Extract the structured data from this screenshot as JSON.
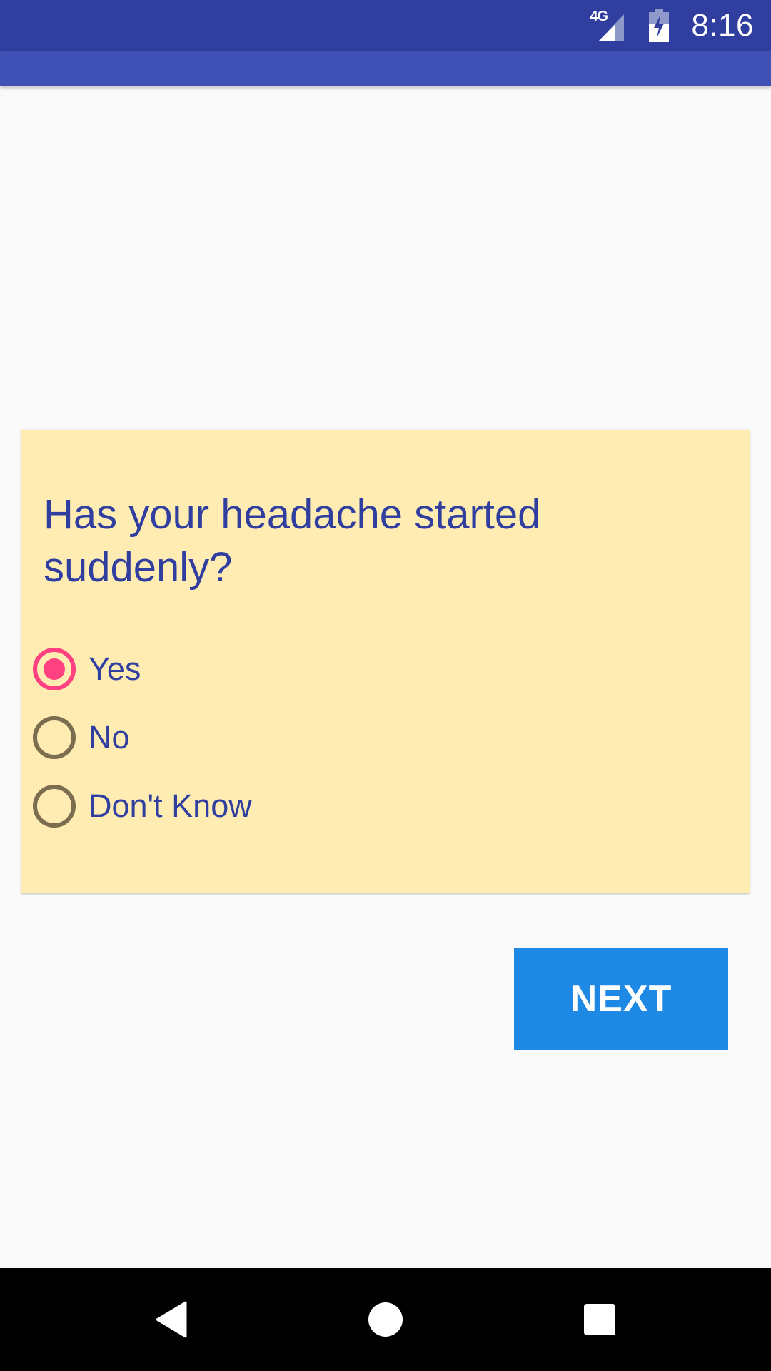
{
  "status_bar": {
    "network_label": "4G",
    "time": "8:16",
    "background_color": "#303f9f"
  },
  "app_bar": {
    "background_color": "#3f51b5"
  },
  "question": {
    "text": "Has your headache started suddenly?",
    "card_color": "#ffecb3",
    "options": [
      {
        "label": "Yes",
        "selected": true
      },
      {
        "label": "No",
        "selected": false
      },
      {
        "label": "Don't Know",
        "selected": false
      }
    ]
  },
  "next_button": {
    "label": "NEXT",
    "color": "#1e88e5"
  },
  "nav_bar": {
    "back_icon": "back-triangle-icon",
    "home_icon": "home-circle-icon",
    "recents_icon": "recents-square-icon"
  },
  "accent_color": "#ff4081"
}
